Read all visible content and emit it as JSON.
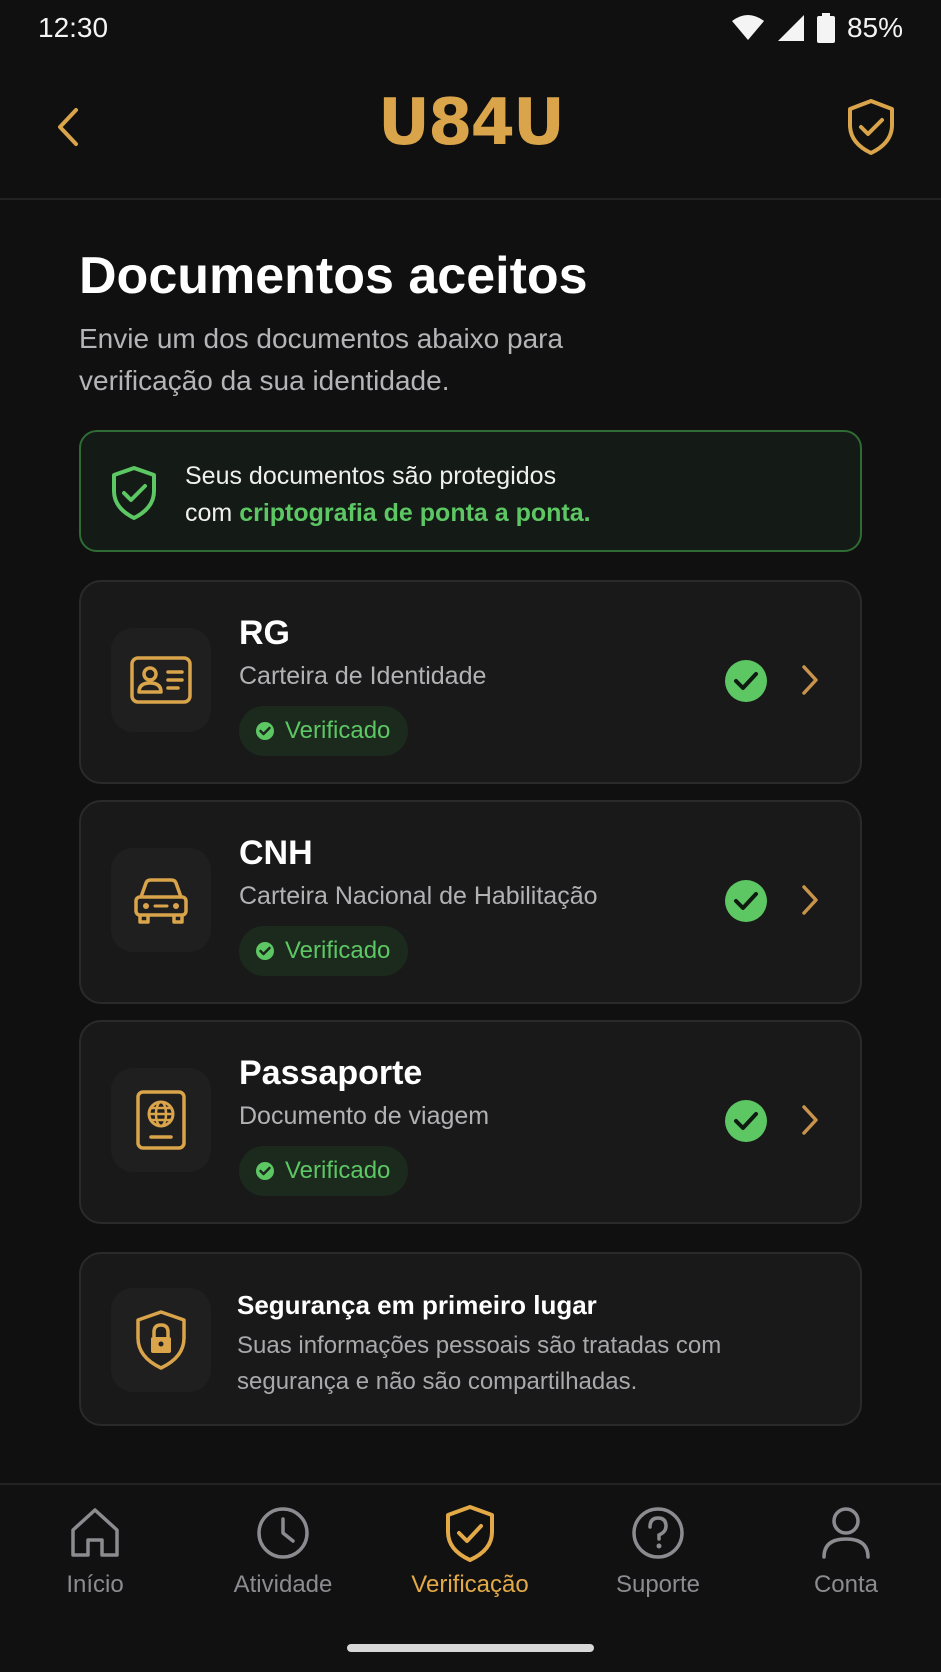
{
  "status_bar": {
    "time": "12:30",
    "battery": "85%"
  },
  "app": {
    "logo": "U84U"
  },
  "header": {
    "title": "Documentos aceitos",
    "subtitle": "Envie um dos documentos abaixo para verificação da sua identidade."
  },
  "security_banner": {
    "text_line1": "Seus documentos são protegidos",
    "text_prefix": "com ",
    "text_highlight": "criptografia de ponta a ponta."
  },
  "documents": [
    {
      "name": "RG",
      "description": "Carteira de Identidade",
      "status": "Verificado",
      "icon": "id-card-icon"
    },
    {
      "name": "CNH",
      "description": "Carteira Nacional de Habilitação",
      "status": "Verificado",
      "icon": "car-icon"
    },
    {
      "name": "Passaporte",
      "description": "Documento de viagem",
      "status": "Verificado",
      "icon": "passport-icon"
    }
  ],
  "info_card": {
    "title": "Segurança em primeiro lugar",
    "description": "Suas informações pessoais são tratadas com segurança e não são compartilhadas."
  },
  "nav": {
    "items": [
      {
        "label": "Início",
        "icon": "home-icon"
      },
      {
        "label": "Atividade",
        "icon": "clock-icon"
      },
      {
        "label": "Verificação",
        "icon": "shield-check-icon",
        "active": true
      },
      {
        "label": "Suporte",
        "icon": "help-icon"
      },
      {
        "label": "Conta",
        "icon": "user-icon"
      }
    ]
  },
  "colors": {
    "accent_gold": "#d9a44a",
    "success_green": "#5cc763",
    "background": "#101011"
  }
}
